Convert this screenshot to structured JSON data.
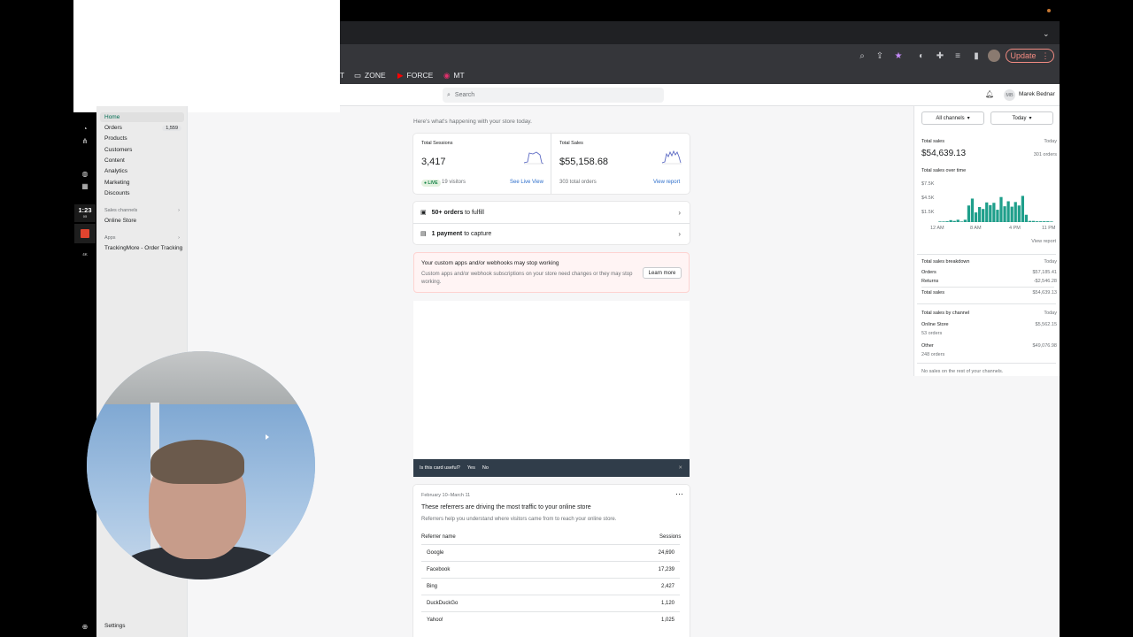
{
  "browser": {
    "bookmarks": [
      {
        "label": "T",
        "icon": "bookmark-icon"
      },
      {
        "label": "ZONE",
        "icon": "folder-icon"
      },
      {
        "label": "FORCE",
        "icon": "youtube-icon"
      },
      {
        "label": "MT",
        "icon": "instagram-icon"
      }
    ],
    "update_label": "Update"
  },
  "recorder": {
    "timer": "1:23",
    "timer_sub": "05",
    "label": "4K"
  },
  "topbar": {
    "search_placeholder": "Search",
    "avatar_initials": "MB",
    "user_name": "Marek Bednar"
  },
  "sidebar": {
    "items": [
      {
        "label": "Home"
      },
      {
        "label": "Orders",
        "badge": "1,559"
      },
      {
        "label": "Products"
      },
      {
        "label": "Customers"
      },
      {
        "label": "Content"
      },
      {
        "label": "Analytics"
      },
      {
        "label": "Marketing"
      },
      {
        "label": "Discounts"
      }
    ],
    "sales_channels_label": "Sales channels",
    "online_store": "Online Store",
    "apps_label": "Apps",
    "app_item": "TrackingMore - Order Tracking",
    "settings": "Settings"
  },
  "main": {
    "intro": "Here's what's happening with your store today.",
    "sessions": {
      "label": "Total Sessions",
      "value": "3,417",
      "live": "LIVE",
      "visitors": "19 visitors",
      "link": "See Live View"
    },
    "sales": {
      "label": "Total Sales",
      "value": "$55,158.68",
      "orders": "303 total orders",
      "link": "View report"
    },
    "todo": [
      {
        "bold": "50+ orders",
        "rest": " to fulfill"
      },
      {
        "bold": "1 payment",
        "rest": " to capture"
      }
    ],
    "warning": {
      "title": "Your custom apps and/or webhooks may stop working",
      "body": "Custom apps and/or webhook subscriptions on your store need changes or they may stop working.",
      "button": "Learn more"
    },
    "feedback": {
      "question": "Is this card useful?",
      "yes": "Yes",
      "no": "No"
    },
    "referrers": {
      "date_range": "February 10–March 11",
      "title": "These referrers are driving the most traffic to your online store",
      "subtitle": "Referrers help you understand where visitors came from to reach your online store.",
      "col_name": "Referrer name",
      "col_sessions": "Sessions",
      "rows": [
        {
          "name": "Google",
          "sessions": "24,690"
        },
        {
          "name": "Facebook",
          "sessions": "17,239"
        },
        {
          "name": "Bing",
          "sessions": "2,427"
        },
        {
          "name": "DuckDuckGo",
          "sessions": "1,120"
        },
        {
          "name": "Yahoo!",
          "sessions": "1,025"
        }
      ]
    }
  },
  "right": {
    "channels_btn": "All channels",
    "date_btn": "Today",
    "total_sales_label": "Total sales",
    "total_sales_period": "Today",
    "total_sales_value": "$54,639.13",
    "total_orders": "301 orders",
    "over_time_label": "Total sales over time",
    "y_ticks": [
      "$7.5K",
      "$4.5K",
      "$1.5K"
    ],
    "x_ticks": [
      "12 AM",
      "8 AM",
      "4 PM",
      "11 PM"
    ],
    "view_report": "View report",
    "breakdown": {
      "label": "Total sales breakdown",
      "period": "Today",
      "rows": [
        {
          "name": "Orders",
          "value": "$57,185.41"
        },
        {
          "name": "Returns",
          "value": "-$2,546.28"
        },
        {
          "name": "Total sales",
          "value": "$54,639.13"
        }
      ]
    },
    "by_channel": {
      "label": "Total sales by channel",
      "period": "Today",
      "rows": [
        {
          "name": "Online Store",
          "orders": "53 orders",
          "value": "$5,562.15"
        },
        {
          "name": "Other",
          "orders": "248 orders",
          "value": "$49,076.98"
        }
      ],
      "note": "No sales on the rest of your channels."
    },
    "accent": "#1f9f8b"
  },
  "chart_data": {
    "type": "bar",
    "title": "Total sales over time",
    "x_ticks": [
      "12 AM",
      "8 AM",
      "4 PM",
      "11 PM"
    ],
    "y_ticks": [
      "$1.5K",
      "$4.5K",
      "$7.5K"
    ],
    "values": [
      0.1,
      0.1,
      0.2,
      0.5,
      0.3,
      0.6,
      0.1,
      0.6,
      4.3,
      6.1,
      2.5,
      3.9,
      3.4,
      5.1,
      4.4,
      5.0,
      3.2,
      6.5,
      4.1,
      5.4,
      4.0,
      5.2,
      4.3,
      6.8,
      1.9,
      0.3,
      0.3,
      0.2,
      0.2,
      0.2,
      0.2,
      0.1
    ],
    "ylim": [
      0,
      8.5
    ],
    "unit": "$K"
  }
}
